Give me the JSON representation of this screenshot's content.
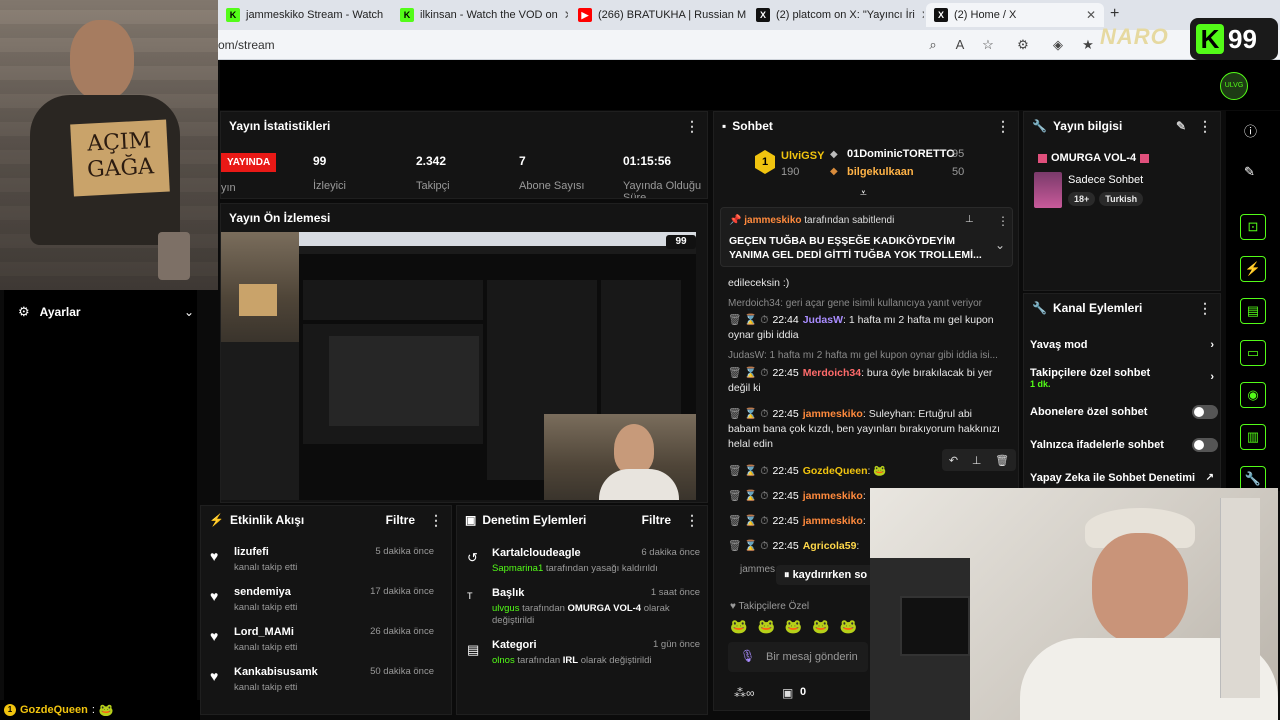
{
  "browser": {
    "tabs": [
      {
        "label": "jammeskiko Stream - Watch",
        "icon": "kick-icon",
        "color": "#53fc18"
      },
      {
        "label": "ilkinsan - Watch the VOD on",
        "icon": "kick-icon",
        "color": "#53fc18"
      },
      {
        "label": "(266) BRATUKHA | Russian M",
        "icon": "youtube-icon",
        "color": "#ff0000"
      },
      {
        "label": "(2) platcom on X: \"Yayıncı İri",
        "icon": "x-icon",
        "color": "#000000"
      },
      {
        "label": "(2) Home / X",
        "icon": "x-icon",
        "color": "#000000"
      }
    ],
    "url": "om/stream",
    "new_tab": "+"
  },
  "overlay": {
    "sign_text": "AÇIM\nGAĞA",
    "logo_text": "NARO",
    "kick_badge": "99"
  },
  "stats": {
    "title": "Yayın İstatistikleri",
    "live": "YAYINDA",
    "live_sub": "yın",
    "items": [
      {
        "value": "99",
        "label": "İzleyici"
      },
      {
        "value": "2.342",
        "label": "Takipçi"
      },
      {
        "value": "7",
        "label": "Abone Sayısı"
      },
      {
        "value": "01:15:56",
        "label": "Yayında Olduğu Süre"
      }
    ]
  },
  "preview": {
    "title": "Yayın Ön İzlemesi"
  },
  "settings": {
    "title": "Ayarlar"
  },
  "chat": {
    "title": "Sohbet",
    "top": [
      {
        "name": "UlviGSY",
        "amount": "190",
        "rank": "1"
      },
      {
        "name": "01DominicTORETTO",
        "amount": "95"
      },
      {
        "name": "bilgekulkaan",
        "amount": "50"
      }
    ],
    "pinned_by": "jammeskiko",
    "pinned_suffix": "tarafından sabitlendi",
    "pinned_text": "GEÇEN TUĞBA BU EŞŞEĞE KADIKÖYDEYİM YANIMA GEL DEDİ GİTTİ TUĞBA YOK TROLLEMİ...",
    "partial": "edileceksin :)",
    "messages": [
      {
        "reply": "Merdoich34: geri açar gene isimli kullanıcıya yanıt veriyor",
        "time": "22:44",
        "user": "JudasW",
        "color": "#a98cff",
        "text": "1 hafta mı 2 hafta mı gel kupon oynar gibi iddia"
      },
      {
        "reply": "JudasW: 1 hafta mı 2 hafta mı gel kupon oynar gibi iddia isi...",
        "time": "22:45",
        "user": "Merdoich34",
        "color": "#ff6b6b",
        "text": "bura öyle bırakılacak bi yer değil ki"
      },
      {
        "time": "22:45",
        "user": "jammeskiko",
        "color": "#ff8a3d",
        "text": "Suleyhan: Ertuğrul abi babam bana çok kızdı, ben yayınları bırakıyorum hakkınızı helal edin"
      },
      {
        "time": "22:45",
        "user": "GozdeQueen",
        "color": "#f1c40f",
        "text": ""
      },
      {
        "time": "22:45",
        "user": "jammeskiko",
        "color": "#ff8a3d",
        "text": ""
      },
      {
        "time": "22:45",
        "user": "jammeskiko",
        "color": "#ff8a3d",
        "text": ""
      },
      {
        "time": "22:45",
        "user": "Agricola59",
        "color": "#ffd84a",
        "text": ""
      }
    ],
    "paused": "kaydırırken so",
    "followers_only": "Takipçilere Özel",
    "placeholder": "Bir mesaj gönderin",
    "footer_count": "0",
    "partial_user": "jammes"
  },
  "stream_info": {
    "title": "Yayın bilgisi",
    "stream_title": "OMURGA VOL-4",
    "category": "Sadece Sohbet",
    "tags": [
      "18+",
      "Turkish"
    ]
  },
  "channel_actions": {
    "title": "Kanal Eylemleri",
    "items": [
      {
        "label": "Yavaş mod",
        "type": "arrow"
      },
      {
        "label": "Takipçilere özel sohbet",
        "sub": "1 dk.",
        "type": "arrow"
      },
      {
        "label": "Abonelere özel sohbet",
        "type": "toggle"
      },
      {
        "label": "Yalnızca ifadelerle sohbet",
        "type": "toggle"
      },
      {
        "label": "Yapay Zeka ile Sohbet Denetimi",
        "type": "link"
      }
    ]
  },
  "activity": {
    "title": "Etkinlik Akışı",
    "filter": "Filtre",
    "items": [
      {
        "name": "lizufefi",
        "sub": "kanalı takip etti",
        "time": "5 dakika önce"
      },
      {
        "name": "sendemiya",
        "sub": "kanalı takip etti",
        "time": "17 dakika önce"
      },
      {
        "name": "Lord_MAMi",
        "sub": "kanalı takip etti",
        "time": "26 dakika önce"
      },
      {
        "name": "Kankabisusamk",
        "sub": "kanalı takip etti",
        "time": "50 dakika önce"
      }
    ]
  },
  "moderation": {
    "title": "Denetim Eylemleri",
    "filter": "Filtre",
    "items": [
      {
        "name": "Kartalcloudeagle",
        "by": "Sapmarina1",
        "rest": "tarafından yasağı kaldırıldı",
        "time": "6 dakika önce",
        "icon": "undo-icon"
      },
      {
        "name": "Başlık",
        "by": "ulvgus",
        "mid": "tarafından",
        "val": "OMURGA VOL-4",
        "rest": "olarak değiştirildi",
        "time": "1 saat önce",
        "icon": "title-icon"
      },
      {
        "name": "Kategori",
        "by": "olnos",
        "mid": "tarafından",
        "val": "IRL",
        "rest": "olarak değiştirildi",
        "time": "1 gün önce",
        "icon": "category-icon"
      }
    ]
  },
  "ticker": {
    "user": "GozdeQueen",
    "sep": ":",
    "rank": "1"
  },
  "colors": {
    "accent": "#53fc18",
    "live": "#e91916",
    "panel": "#141414"
  }
}
